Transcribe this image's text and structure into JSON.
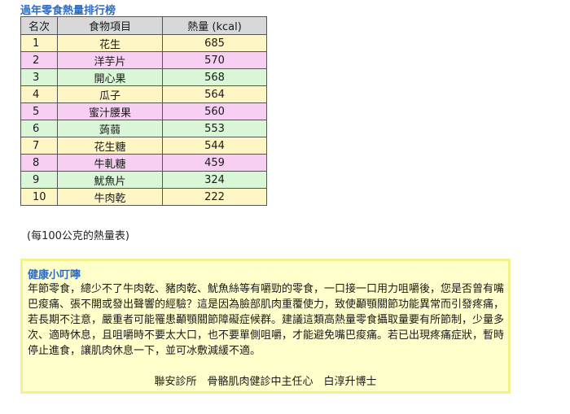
{
  "heading": "過年零食熱量排行榜",
  "table": {
    "headers": [
      "名次",
      "食物項目",
      "熱量 (kcal)"
    ],
    "rows": [
      {
        "rank": "1",
        "food": "花生",
        "kcal": "685",
        "color": "#fff6c6"
      },
      {
        "rank": "2",
        "food": "洋芋片",
        "kcal": "570",
        "color": "#f6cff2"
      },
      {
        "rank": "3",
        "food": "開心果",
        "kcal": "568",
        "color": "#d9f6d6"
      },
      {
        "rank": "4",
        "food": "瓜子",
        "kcal": "564",
        "color": "#fff6c6"
      },
      {
        "rank": "5",
        "food": "蜜汁腰果",
        "kcal": "560",
        "color": "#f6cff2"
      },
      {
        "rank": "6",
        "food": "蒟蒻",
        "kcal": "553",
        "color": "#d9f6d6"
      },
      {
        "rank": "7",
        "food": "花生糖",
        "kcal": "544",
        "color": "#fff6c6"
      },
      {
        "rank": "8",
        "food": "牛軋糖",
        "kcal": "459",
        "color": "#f6cff2"
      },
      {
        "rank": "9",
        "food": "魷魚片",
        "kcal": "324",
        "color": "#d9f6d6"
      },
      {
        "rank": "10",
        "food": "牛肉乾",
        "kcal": "222",
        "color": "#fff6c6"
      }
    ]
  },
  "note": "(每100公克的熱量表)",
  "tip": {
    "title": "健康小叮嚀",
    "body_lines": [
      "年節零食，總少不了牛肉乾、豬肉乾、魷魚絲等有嚼勁的零食，一口接一口用力咀嚼後，您是否曾有嘴",
      "巴痠痛、張不開或發出聲響的經驗？這是因為臉部肌肉重覆使力，致使顳顎關節功能異常而引發疼痛，",
      "若長期不注意，嚴重者可能罹患顳顎關節障礙症候群。建議這類高熱量零食攝取量要有所節制，少量多",
      "次、適時休息，且咀嚼時不要太大口，也不要單側咀嚼，才能避免嘴巴痠痛。若已出現疼痛症狀，暫時",
      "停止進食，讓肌肉休息一下，並可冰敷減緩不適。"
    ],
    "signature": "聯安診所　骨骼肌肉健診中主任心　白淳升博士"
  },
  "colors": {
    "heading": "#2f6cc0",
    "row_yellow": "#fff6c6",
    "row_pink": "#f6cff2",
    "row_green": "#d9f6d6",
    "header_bg": "#d8d8d8",
    "tip_bg": "#ffffcc",
    "tip_border": "#f4f08a"
  }
}
